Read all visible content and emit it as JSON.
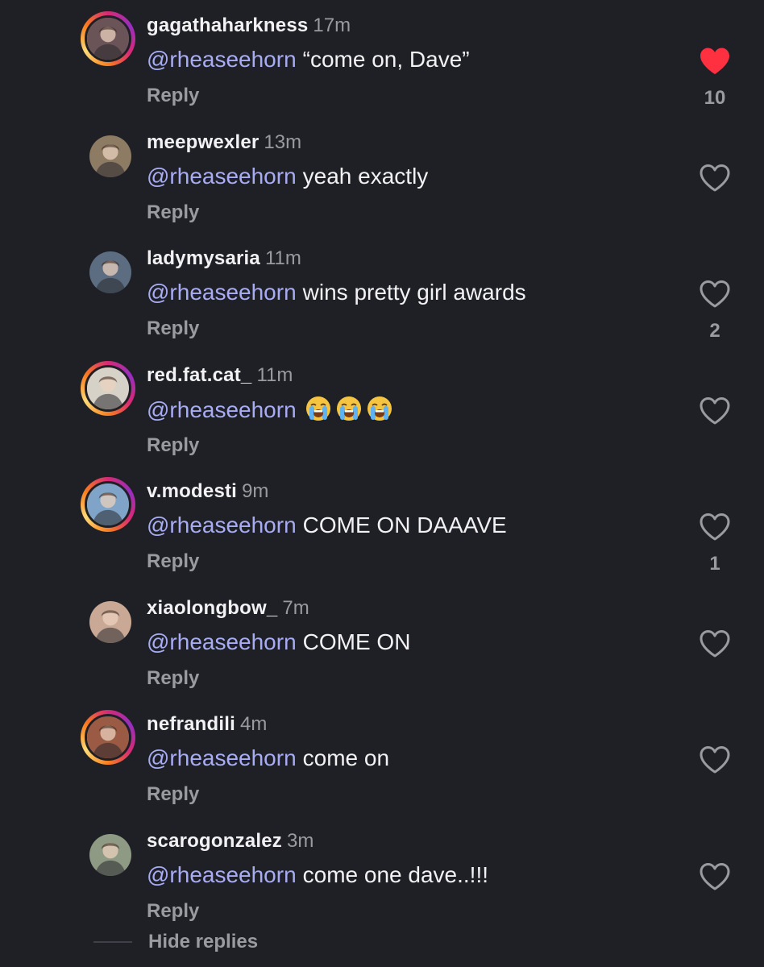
{
  "comments": [
    {
      "username": "gagathaharkness",
      "time": "17m",
      "mention": "@rheaseehorn",
      "text": "“come on, Dave”",
      "reply": "Reply",
      "likes": "10",
      "liked": true,
      "story": true,
      "avatar_color": "#6b5458"
    },
    {
      "username": "meepwexler",
      "time": "13m",
      "mention": "@rheaseehorn",
      "text": "yeah exactly",
      "reply": "Reply",
      "likes": "",
      "liked": false,
      "story": false,
      "avatar_color": "#8d7b63"
    },
    {
      "username": "ladymysaria",
      "time": "11m",
      "mention": "@rheaseehorn",
      "text": "wins pretty girl awards",
      "reply": "Reply",
      "likes": "2",
      "liked": false,
      "story": false,
      "avatar_color": "#5c6d82"
    },
    {
      "username": "red.fat.cat_",
      "time": "11m",
      "mention": "@rheaseehorn",
      "text": "",
      "emoji_count": 3,
      "emoji_name": "loudly-crying-face",
      "reply": "Reply",
      "likes": "",
      "liked": false,
      "story": true,
      "avatar_color": "#d7d2c8"
    },
    {
      "username": "v.modesti",
      "time": "9m",
      "mention": "@rheaseehorn",
      "text": "COME ON DAAAVE",
      "reply": "Reply",
      "likes": "1",
      "liked": false,
      "story": true,
      "avatar_color": "#7fa4c7"
    },
    {
      "username": "xiaolongbow_",
      "time": "7m",
      "mention": "@rheaseehorn",
      "text": "COME ON",
      "reply": "Reply",
      "likes": "",
      "liked": false,
      "story": false,
      "avatar_color": "#c9a996"
    },
    {
      "username": "nefrandili",
      "time": "4m",
      "mention": "@rheaseehorn",
      "text": "come on",
      "reply": "Reply",
      "likes": "",
      "liked": false,
      "story": true,
      "avatar_color": "#9b5a44"
    },
    {
      "username": "scarogonzalez",
      "time": "3m",
      "mention": "@rheaseehorn",
      "text": "come one dave..!!!",
      "reply": "Reply",
      "likes": "",
      "liked": false,
      "story": false,
      "avatar_color": "#8f9a84"
    }
  ],
  "hide_replies": "Hide replies",
  "colors": {
    "background": "#1f2025",
    "mention": "#a7acf4",
    "muted": "#9a9ba1",
    "like_active": "#ff3040"
  }
}
